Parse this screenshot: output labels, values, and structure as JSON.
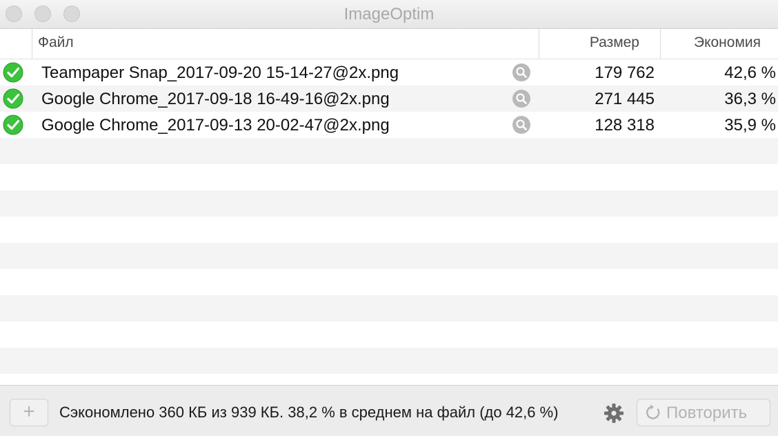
{
  "window": {
    "title": "ImageOptim"
  },
  "columns": {
    "file": "Файл",
    "size": "Размер",
    "savings": "Экономия"
  },
  "files": [
    {
      "name": "Teampaper Snap_2017-09-20 15-14-27@2x.png",
      "size": "179 762",
      "savings": "42,6 %",
      "status": "check-icon"
    },
    {
      "name": "Google Chrome_2017-09-18 16-49-16@2x.png",
      "size": "271 445",
      "savings": "36,3 %",
      "status": "check-icon"
    },
    {
      "name": "Google Chrome_2017-09-13 20-02-47@2x.png",
      "size": "128 318",
      "savings": "35,9 %",
      "status": "check-icon"
    }
  ],
  "footer": {
    "add_label": "+",
    "summary": "Сэкономлено 360 КБ из 939 КБ. 38,2 % в среднем на файл (до 42,6 %)",
    "retry_label": "Повторить"
  },
  "colors": {
    "success": "#3cc23c",
    "muted": "#b3b3b3"
  }
}
